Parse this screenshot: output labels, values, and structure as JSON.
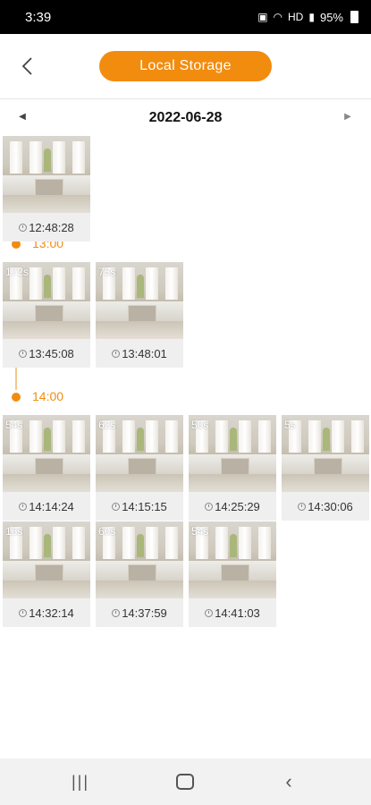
{
  "status_bar": {
    "time": "3:39",
    "network": "HD",
    "battery": "95%"
  },
  "header": {
    "title": "Local Storage"
  },
  "date_bar": {
    "date": "2022-06-28"
  },
  "timeline": {
    "hours": [
      "13:00",
      "14:00"
    ],
    "clips": [
      {
        "duration": "",
        "time": "12:48:28"
      },
      {
        "duration": "172s",
        "time": "13:45:08"
      },
      {
        "duration": "75s",
        "time": "13:48:01"
      },
      {
        "duration": "54s",
        "time": "14:14:24"
      },
      {
        "duration": "62s",
        "time": "14:15:15"
      },
      {
        "duration": "50s",
        "time": "14:25:29"
      },
      {
        "duration": "5s",
        "time": "14:30:06"
      },
      {
        "duration": "16s",
        "time": "14:32:14"
      },
      {
        "duration": "60s",
        "time": "14:37:59"
      },
      {
        "duration": "54s",
        "time": "14:41:03"
      }
    ]
  },
  "icons": {
    "back": "chevron-left-icon",
    "prev_day": "triangle-left-icon",
    "next_day": "triangle-right-icon",
    "clock": "clock-icon"
  },
  "colors": {
    "accent": "#f28c0f"
  }
}
